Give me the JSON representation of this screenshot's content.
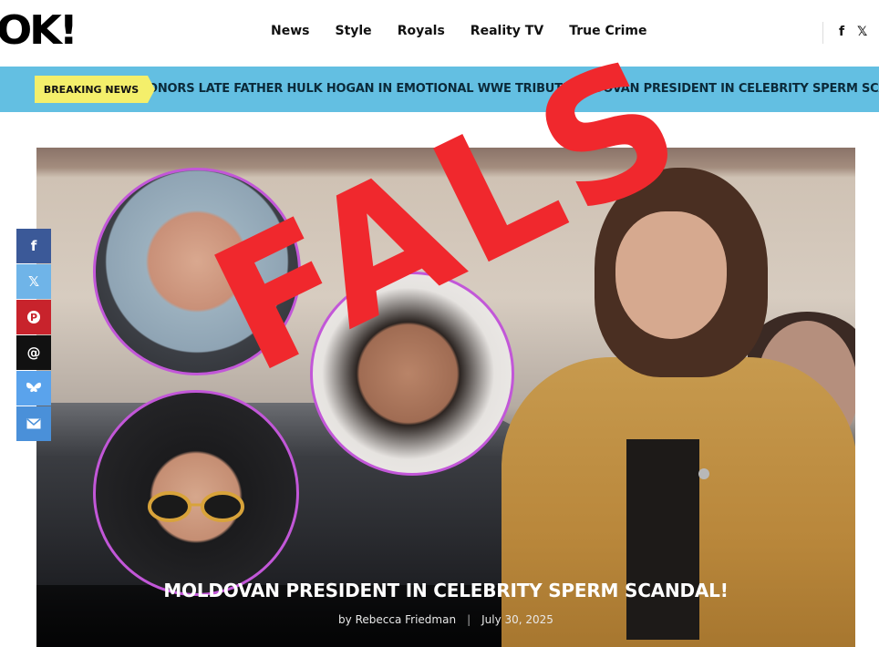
{
  "header": {
    "logo": "OK!",
    "nav": [
      "News",
      "Style",
      "Royals",
      "Reality TV",
      "True Crime"
    ],
    "social": [
      "facebook-icon",
      "x-icon"
    ]
  },
  "ticker": {
    "label": "BREAKING NEWS",
    "items": [
      "ONORS LATE FATHER HULK HOGAN IN EMOTIONAL WWE TRIBUTE",
      "MOLDOVAN PRESIDENT IN CELEBRITY SPERM SCANDA"
    ]
  },
  "overlay": {
    "stamp": "FALS"
  },
  "article": {
    "headline": "MOLDOVAN PRESIDENT IN CELEBRITY SPERM SCANDAL!",
    "author": "by Rebecca Friedman",
    "date": "July 30, 2025"
  },
  "share": {
    "buttons": [
      "facebook-icon",
      "x-icon",
      "pinterest-icon",
      "threads-icon",
      "bluesky-icon",
      "email-icon"
    ],
    "colors": [
      "#3b5998",
      "#6fb4e8",
      "#c8232c",
      "#111111",
      "#5aa3ec",
      "#4a90d9"
    ]
  },
  "colors": {
    "ticker_bg": "#63bfe2",
    "breaking_bg": "#f4ef6b",
    "stamp": "#f0282d",
    "circle_border": "#c257d8"
  }
}
